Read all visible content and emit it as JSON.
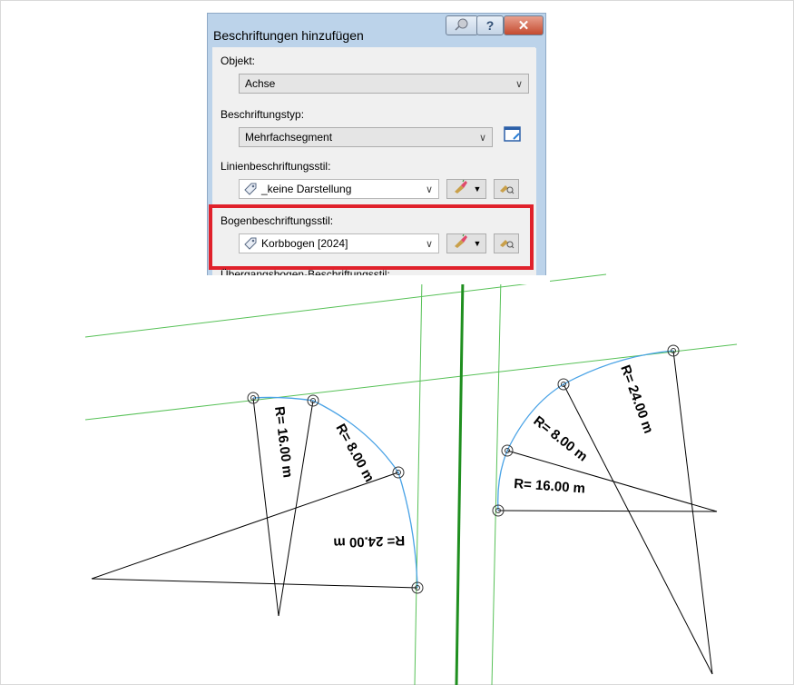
{
  "dialog": {
    "title": "Beschriftungen hinzufügen",
    "help_glyph": "?",
    "close_glyph": "✕",
    "objekt_label": "Objekt:",
    "objekt_value": "Achse",
    "typ_label": "Beschriftungstyp:",
    "typ_value": "Mehrfachsegment",
    "linien_label": "Linienbeschriftungsstil:",
    "linien_value": "_keine Darstellung",
    "bogen_label": "Bogenbeschriftungsstil:",
    "bogen_value": "Korbbogen [2024]",
    "uebergang_label": "Übergangsbogen-Beschriftungsstil:"
  },
  "drawing": {
    "left_labels": [
      "R= 16.00 m",
      "R= 8.00 m",
      "R= 24.00 m"
    ],
    "right_labels": [
      "R= 24.00 m",
      "R= 8.00 m",
      "R= 16.00 m"
    ],
    "colors": {
      "alignment": "#57c157",
      "main_axis": "#1f8f1f",
      "arc": "#4aa3e6",
      "construction": "#000000",
      "highlight": "#e0212b"
    }
  }
}
